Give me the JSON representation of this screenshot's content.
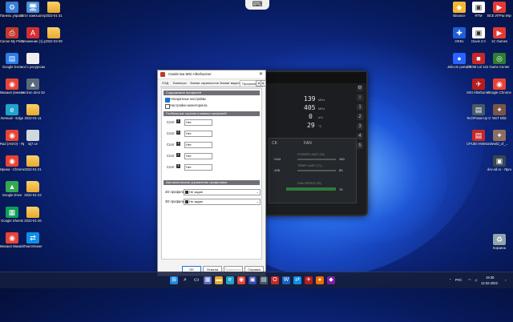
{
  "desktop": {
    "left_icons": [
      {
        "label": "Панель управл...",
        "icon": "control-panel-icon",
        "color": "#3a7bd5",
        "glyph": "⚙"
      },
      {
        "label": "Этот компьютер",
        "icon": "computer-icon",
        "color": "#4a90d9",
        "glyph": "🖥"
      },
      {
        "label": "2022-01-31",
        "icon": "folder-icon",
        "color": "folder",
        "glyph": ""
      },
      {
        "label": "Canon My Printer",
        "icon": "printer-icon",
        "color": "#c0392b",
        "glyph": "⎙"
      },
      {
        "label": "Сочинение (1).pdf",
        "icon": "pdf-icon",
        "color": "#d32f2f",
        "glyph": "A"
      },
      {
        "label": "2022-02-09",
        "icon": "folder-icon",
        "color": "folder",
        "glyph": ""
      },
      {
        "label": "Google Docs",
        "icon": "google-docs-icon",
        "color": "#2b7de9",
        "glyph": "▤"
      },
      {
        "label": "acd с ресурсами",
        "icon": "file-icon",
        "color": "#eeeeee",
        "glyph": ""
      },
      {
        "label": "Михаил (внешний...",
        "icon": "chrome-icon",
        "color": "#e94335",
        "glyph": "◉"
      },
      {
        "label": "Horizon Zero Dawn",
        "icon": "game-icon",
        "color": "#5a6b7c",
        "glyph": "▲"
      },
      {
        "label": "Личный - Edge",
        "icon": "edge-icon",
        "color": "#1fa3c9",
        "glyph": "e"
      },
      {
        "label": "2022-01-11",
        "icon": "folder-icon",
        "color": "folder",
        "glyph": ""
      },
      {
        "label": "Rad (AGIO) - Ярлык",
        "icon": "chrome-icon",
        "color": "#e94335",
        "glyph": "◉"
      },
      {
        "label": "sij7.ce",
        "icon": "file-icon",
        "color": "#cfd8dc",
        "glyph": ""
      },
      {
        "label": "Ирина - Chrome",
        "icon": "chrome-icon",
        "color": "#e94335",
        "glyph": "◉"
      },
      {
        "label": "2022-01-21",
        "icon": "folder-icon",
        "color": "folder",
        "glyph": ""
      },
      {
        "label": "Google Drive",
        "icon": "google-drive-icon",
        "color": "#34a853",
        "glyph": "▲"
      },
      {
        "label": "2022-01-22",
        "icon": "folder-icon",
        "color": "folder",
        "glyph": ""
      },
      {
        "label": "Google Sheets",
        "icon": "google-sheets-icon",
        "color": "#0f9d58",
        "glyph": "▦"
      },
      {
        "label": "2022-01-26",
        "icon": "folder-icon",
        "color": "folder",
        "glyph": ""
      },
      {
        "label": "Михаил Михайлов",
        "icon": "chrome-icon",
        "color": "#e94335",
        "glyph": "◉"
      },
      {
        "label": "TeamViewer",
        "icon": "teamviewer-icon",
        "color": "#0e8ee9",
        "glyph": "⇄"
      }
    ],
    "right_icons": [
      {
        "label": "Binance",
        "icon": "binance-icon",
        "color": "#f3ba2f",
        "glyph": "◆"
      },
      {
        "label": "RTM",
        "icon": "rtm-icon",
        "color": "#ffffff",
        "glyph": "▣"
      },
      {
        "label": "ВСЕ ИГРЫ Игровой ц...",
        "icon": "games-icon",
        "color": "#e53935",
        "glyph": "▶"
      },
      {
        "label": "OKEx",
        "icon": "okex-icon",
        "color": "#1e5fd6",
        "glyph": "✚"
      },
      {
        "label": "Davis 2.0",
        "icon": "app-icon",
        "color": "#ffffff",
        "glyph": "▣"
      },
      {
        "label": "1С Games",
        "icon": "1c-icon",
        "color": "#e53935",
        "glyph": "▶"
      },
      {
        "label": "Jelicom portable",
        "icon": "app-icon",
        "color": "#2962ff",
        "glyph": "●"
      },
      {
        "label": "TOM Lol 142",
        "icon": "app-icon",
        "color": "#c62828",
        "glyph": "■"
      },
      {
        "label": "Game Center",
        "icon": "game-center-icon",
        "color": "#2e7d32",
        "glyph": "◎"
      },
      {
        "label": "MSI Afterburner",
        "icon": "msi-afterburner-icon",
        "color": "#b71c1c",
        "glyph": "✈"
      },
      {
        "label": "Google Chrome",
        "icon": "chrome-icon",
        "color": "#e94335",
        "glyph": "◉"
      },
      {
        "label": "TechPowerUp GPU-Z",
        "icon": "gpuz-icon",
        "color": "#455a64",
        "glyph": "▤"
      },
      {
        "label": "WoT Blitz",
        "icon": "wot-blitz-icon",
        "color": "#795548",
        "glyph": "✦"
      },
      {
        "label": "CPUID HWMonitor",
        "icon": "hwmonitor-icon",
        "color": "#c62828",
        "glyph": "▤"
      },
      {
        "label": "World_of_...",
        "icon": "world-of-tanks-icon",
        "color": "#8d6e63",
        "glyph": "✦"
      },
      {
        "label": "dev-all.ru - Ярлык",
        "icon": "app-icon",
        "color": "#37474f",
        "glyph": "▣"
      },
      {
        "label": "Корзина",
        "icon": "recycle-bin-icon",
        "color": "#90a4ae",
        "glyph": "♻"
      }
    ]
  },
  "afterburner": {
    "core_clock": "139",
    "core_unit": "MHz",
    "mem_clock": "405",
    "mem_unit": "MHz",
    "voltage": "0",
    "voltage_unit": "mV",
    "temp": "29",
    "temp_unit": "°C",
    "clock_label": "CK",
    "fan_label": "FAN",
    "power_limit_label": "POWER LIMIT (%)",
    "temp_limit_label": "TEMP LIMIT (°C)",
    "fan_speed_label": "FAN SPEED (%)",
    "power_limit_value": "100",
    "temp_limit_value": "83",
    "core_offset": "+144",
    "mem_offset": "-105",
    "fan_value": "75"
  },
  "dialog": {
    "title": "Свойства MSI Afterburner",
    "tabs": [
      "ОЗД",
      "Баннеры",
      "Захват скриншотов",
      "Захват видео",
      "Профили"
    ],
    "active_tab": "Профили",
    "section1": "Содержимое профилей",
    "cb1_label": "Аппаратные настройки",
    "cb1_checked": true,
    "cb2_label": "Настройки мониторинга",
    "cb2_checked": false,
    "section2": "Глобальные горячие клавиши профилей",
    "profile_rows": [
      {
        "label": "Слот",
        "num": "1",
        "value": "Нет"
      },
      {
        "label": "Слот",
        "num": "2",
        "value": "Нет"
      },
      {
        "label": "Слот",
        "num": "3",
        "value": "Нет"
      },
      {
        "label": "Слот",
        "num": "4",
        "value": "Нет"
      },
      {
        "label": "Слот",
        "num": "5",
        "value": "Нет"
      }
    ],
    "section3": "Автоматическое управление профилями",
    "auto_rows": [
      {
        "label": "2D профиль",
        "value": "Не задан"
      },
      {
        "label": "3D профиль",
        "value": "Не задан"
      }
    ],
    "buttons": {
      "ok": "OK",
      "cancel": "Отмена",
      "apply": "Применить",
      "help": "Справка"
    }
  },
  "taskbar": {
    "lang": "РУС",
    "time": "19:30",
    "date": "12.02.2022"
  }
}
